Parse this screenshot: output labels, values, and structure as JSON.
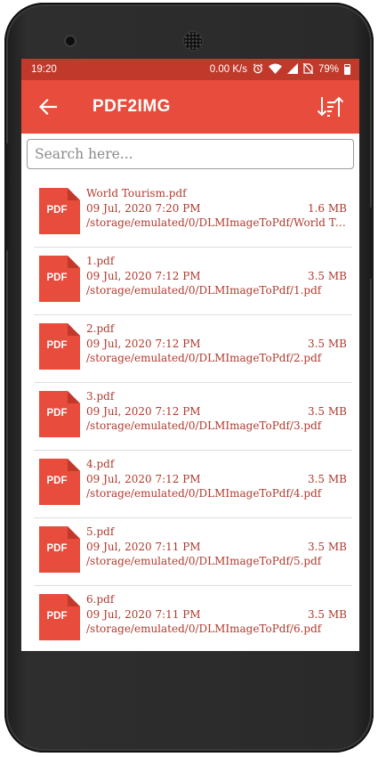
{
  "status_bar": {
    "time": "19:20",
    "speed": "0.00 K/s",
    "battery": "79%",
    "icons": [
      "alarm-icon",
      "wifi-icon",
      "signal-icon",
      "no-sim-icon",
      "battery-icon"
    ]
  },
  "app_bar": {
    "title": "PDF2IMG",
    "back_icon": "arrow-left-icon",
    "sort_icon": "sort-icon"
  },
  "search": {
    "placeholder": "Search here...",
    "value": ""
  },
  "files": [
    {
      "icon_label": "PDF",
      "name": "World Tourism.pdf",
      "date": "09 Jul, 2020 7:20 PM",
      "size": "1.6 MB",
      "path": "/storage/emulated/0/DLMImageToPdf/World To..."
    },
    {
      "icon_label": "PDF",
      "name": "1.pdf",
      "date": "09 Jul, 2020 7:12 PM",
      "size": "3.5 MB",
      "path": "/storage/emulated/0/DLMImageToPdf/1.pdf"
    },
    {
      "icon_label": "PDF",
      "name": "2.pdf",
      "date": "09 Jul, 2020 7:12 PM",
      "size": "3.5 MB",
      "path": "/storage/emulated/0/DLMImageToPdf/2.pdf"
    },
    {
      "icon_label": "PDF",
      "name": "3.pdf",
      "date": "09 Jul, 2020 7:12 PM",
      "size": "3.5 MB",
      "path": "/storage/emulated/0/DLMImageToPdf/3.pdf"
    },
    {
      "icon_label": "PDF",
      "name": "4.pdf",
      "date": "09 Jul, 2020 7:12 PM",
      "size": "3.5 MB",
      "path": "/storage/emulated/0/DLMImageToPdf/4.pdf"
    },
    {
      "icon_label": "PDF",
      "name": "5.pdf",
      "date": "09 Jul, 2020 7:11 PM",
      "size": "3.5 MB",
      "path": "/storage/emulated/0/DLMImageToPdf/5.pdf"
    },
    {
      "icon_label": "PDF",
      "name": "6.pdf",
      "date": "09 Jul, 2020 7:11 PM",
      "size": "3.5 MB",
      "path": "/storage/emulated/0/DLMImageToPdf/6.pdf"
    }
  ],
  "colors": {
    "status_bar": "#c0392b",
    "app_bar": "#e74c3c",
    "pdf_icon": "#e74c3c",
    "text_accent": "#b03a2e"
  }
}
